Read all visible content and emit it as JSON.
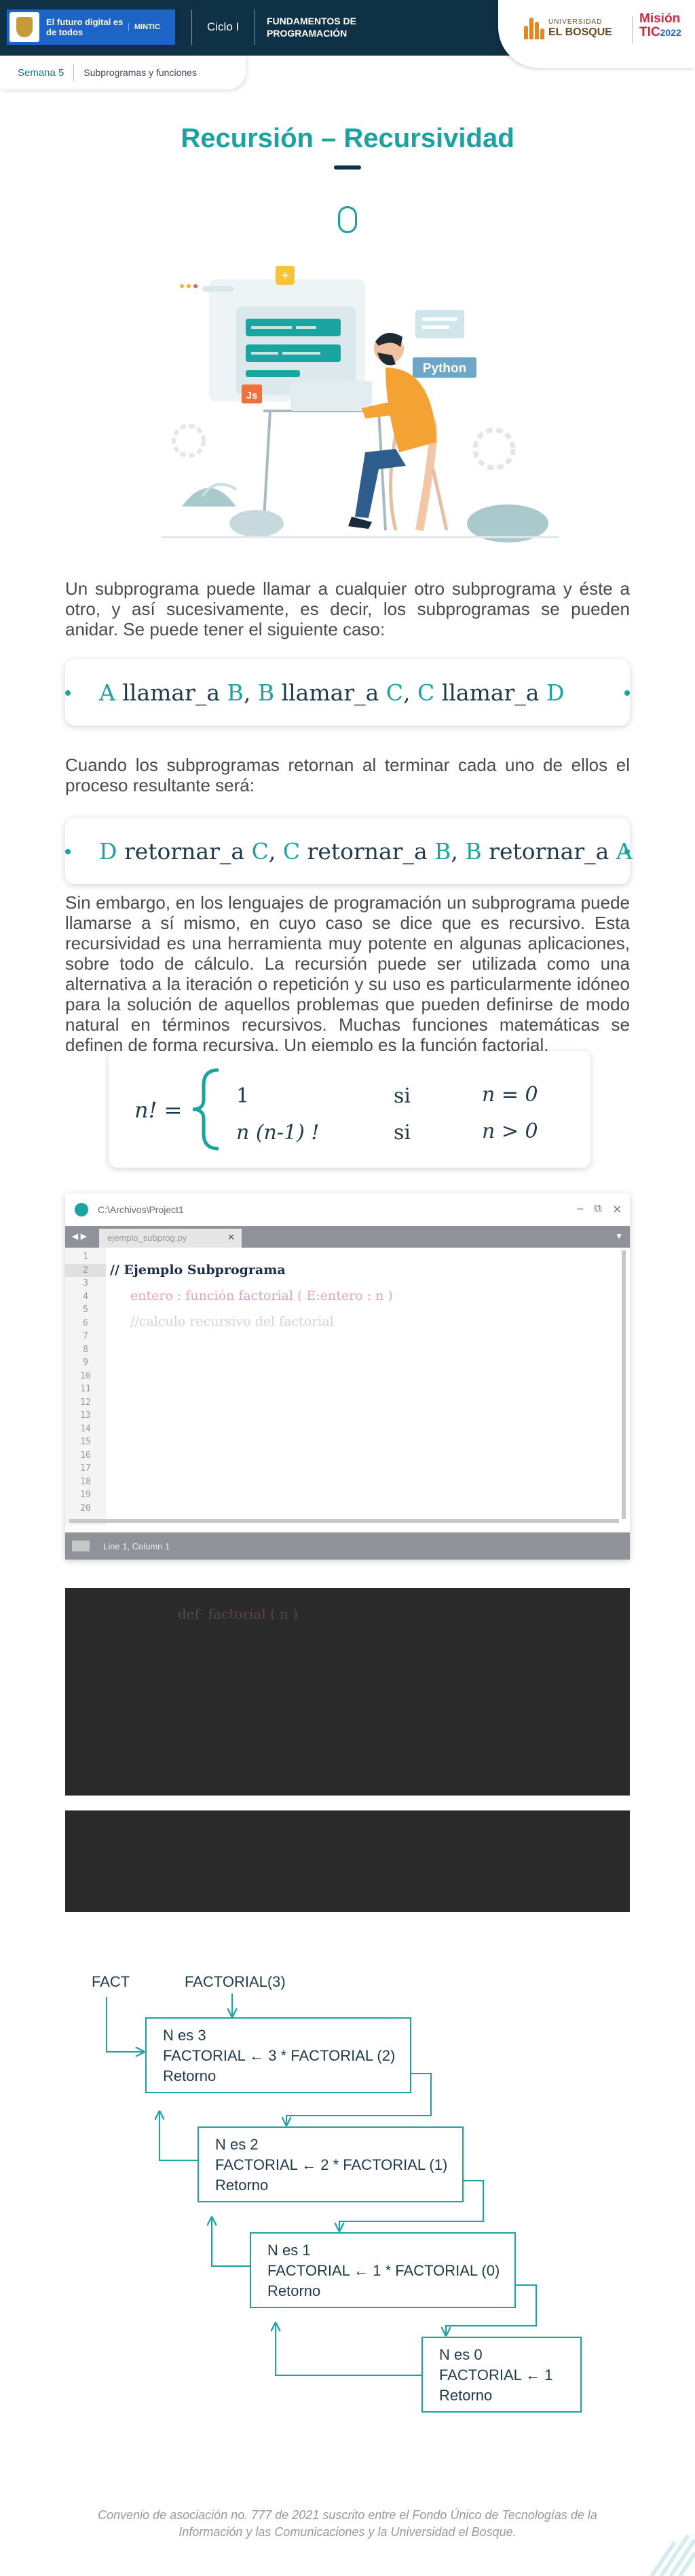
{
  "header": {
    "gov_text": "El futuro digital es de todos",
    "mintic": "MINTIC",
    "ciclo": "Ciclo I",
    "curso_line1": "FUNDAMENTOS DE",
    "curso_line2": "PROGRAMACIÓN",
    "universidad_small": "UNIVERSIDAD",
    "universidad_name": "EL BOSQUE",
    "mision_line1": "Misión",
    "mision_line2": "TIC",
    "mision_year": "2022"
  },
  "week_tab": {
    "semana": "Semana 5",
    "tema": "Subprogramas y funciones"
  },
  "title": "Recursión – Recursividad",
  "illustration": {
    "python_label": "Python",
    "js_label": "Js"
  },
  "paragraph1": "Un subprograma puede llamar a cualquier otro subprograma y éste a otro, y así sucesivamente, es decir, los subprogramas se pueden anidar. Se puede tener el siguiente caso:",
  "box1": {
    "a": "A",
    "call": "llamar_a",
    "b": "B",
    "comma": ",",
    "b2": "B",
    "c": "C",
    "c2": "C",
    "d": "D"
  },
  "paragraph2": "Cuando los subprogramas retornan al terminar cada uno de ellos el proceso resultante será:",
  "box2": {
    "d": "D",
    "ret": "retornar_a",
    "c": "C",
    "comma": ",",
    "c2": "C",
    "b": "B",
    "b2": "B",
    "a": "A"
  },
  "paragraph3": "Sin embargo, en los lenguajes de programación un subprograma puede llamarse a sí mismo, en cuyo caso se dice que es recursivo. Esta recursividad es una herramienta muy potente en algunas aplicaciones, sobre todo de cálculo. La recursión puede ser utilizada como una alternativa a la iteración o repetición y su uso es particularmente idóneo para la solución de aquellos problemas que pueden definirse de modo natural en términos recursivos. Muchas funciones matemáticas se definen de forma recursiva. Un ejemplo es la función factorial.",
  "formula": {
    "lhs": "n! =",
    "row1_value": "1",
    "row1_si": "si",
    "row1_cond": "n = 0",
    "row2_value": "n (n-1) !",
    "row2_si": "si",
    "row2_cond": "n > 0"
  },
  "editor": {
    "path": "C:\\Archivos\\Project1",
    "controls": [
      "–",
      "⧉",
      "✕"
    ],
    "tab_name": "ejemplo_subprog.py",
    "tab_close": "✕",
    "line_numbers": [
      "1",
      "2",
      "3",
      "4",
      "5",
      "6",
      "7",
      "8",
      "9",
      "10",
      "11",
      "12",
      "13",
      "14",
      "15",
      "16",
      "17",
      "18",
      "19",
      "20"
    ],
    "code_line1": "// Ejemplo Subprograma",
    "code_line2_kw": "entero : función",
    "code_line2_fn": "factorial",
    "code_line2_args": "( E:entero : n )",
    "code_line3": "//calculo recursivo del factorial",
    "status": "Line 1, Column 1"
  },
  "terminal1": {
    "kw": "def",
    "code": "factorial ( n )"
  },
  "flow": {
    "fact_label": "FACT",
    "call_label": "FACTORIAL(3)",
    "boxes": [
      {
        "l1": "N es 3",
        "l2": "FACTORIAL ← 3 * FACTORIAL (2)",
        "l3": "Retorno"
      },
      {
        "l1": "N es 2",
        "l2": "FACTORIAL ← 2 * FACTORIAL (1)",
        "l3": "Retorno"
      },
      {
        "l1": "N es 1",
        "l2": "FACTORIAL ← 1 * FACTORIAL (0)",
        "l3": "Retorno"
      },
      {
        "l1": "N es 0",
        "l2": "FACTORIAL ← 1",
        "l3": "Retorno"
      }
    ]
  },
  "footer": {
    "line1": "Convenio de asociación no. 777 de 2021 suscrito entre el Fondo Único de Tecnologías de la",
    "line2": "Información y las Comunicaciones y la Universidad el Bosque."
  },
  "colors": {
    "accent": "#19a3a1",
    "header": "#0f3146",
    "terminal": "#2a2a2a"
  }
}
